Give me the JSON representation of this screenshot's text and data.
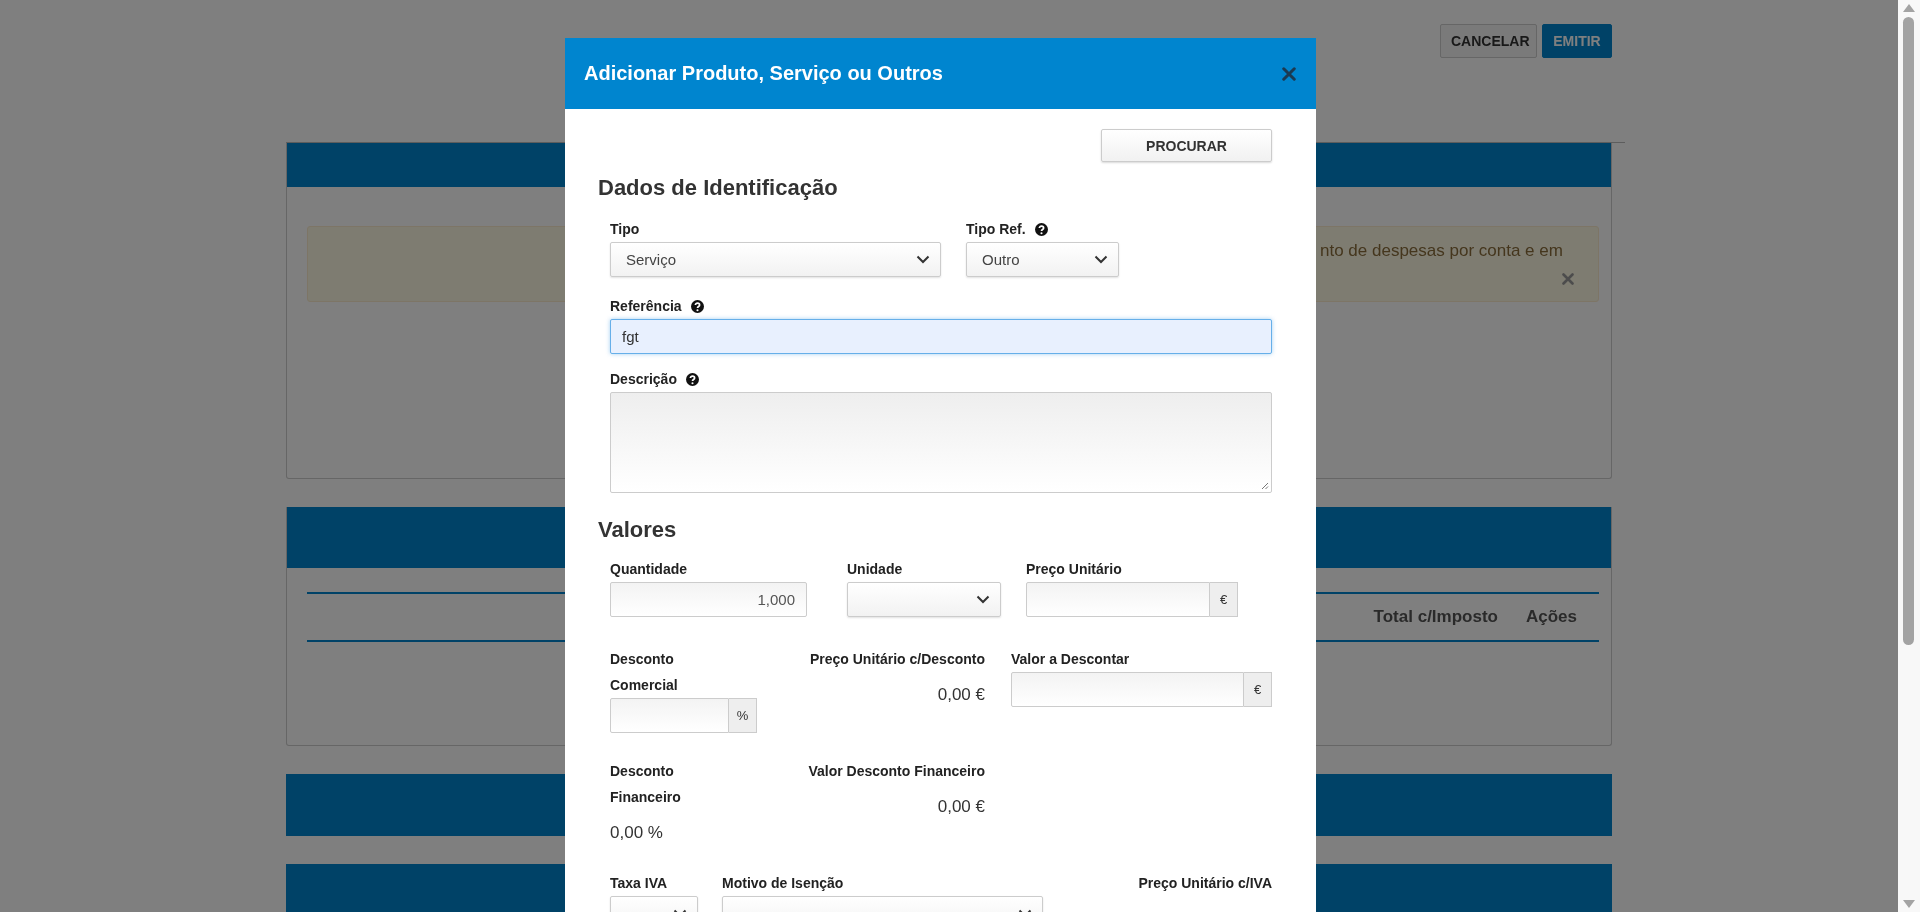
{
  "background": {
    "buttons": [
      {
        "label": "CANCELAR",
        "kind": "secondary"
      },
      {
        "label": "EMITIR",
        "kind": "primary"
      }
    ],
    "alert": {
      "text": "nto de despesas por conta e em"
    },
    "table": {
      "columns": [
        "Total c/Imposto",
        "Ações"
      ]
    }
  },
  "modal": {
    "title": "Adicionar Produto, Serviço ou Outros",
    "search_button": "PROCURAR",
    "sections": [
      {
        "heading": "Dados de Identificação",
        "rows": [
          [
            {
              "kind": "select",
              "label": "Tipo",
              "value": "Serviço"
            },
            {
              "kind": "select",
              "label": "Tipo Ref.",
              "value": "Outro",
              "help": true
            }
          ],
          [
            {
              "kind": "input",
              "label": "Referência",
              "value": "fgt",
              "help": true,
              "focused": true
            }
          ],
          [
            {
              "kind": "textarea",
              "label": "Descrição",
              "help": true
            }
          ]
        ]
      },
      {
        "heading": "Valores",
        "rows": [
          [
            {
              "kind": "input",
              "label": "Quantidade",
              "value": "1,000"
            },
            {
              "kind": "select",
              "label": "Unidade"
            },
            {
              "kind": "addon_input",
              "label": "Preço Unitário",
              "addon": "€"
            }
          ],
          [
            {
              "kind": "addon_input",
              "label": "Desconto Comercial",
              "addon": "%"
            },
            {
              "kind": "readout",
              "label": "Preço Unitário c/Desconto",
              "value": "0,00 €"
            },
            {
              "kind": "addon_input",
              "label": "Valor a Descontar",
              "addon": "€"
            }
          ],
          [
            {
              "kind": "readout",
              "label": "Desconto Financeiro",
              "value": "0,00 %"
            },
            {
              "kind": "readout",
              "label": "Valor Desconto Financeiro",
              "value": "0,00 €"
            }
          ],
          [
            {
              "kind": "select",
              "label": "Taxa IVA"
            },
            {
              "kind": "select",
              "label": "Motivo de Isenção"
            },
            {
              "kind": "readout",
              "label": "Preço Unitário c/IVA"
            }
          ]
        ]
      }
    ]
  }
}
